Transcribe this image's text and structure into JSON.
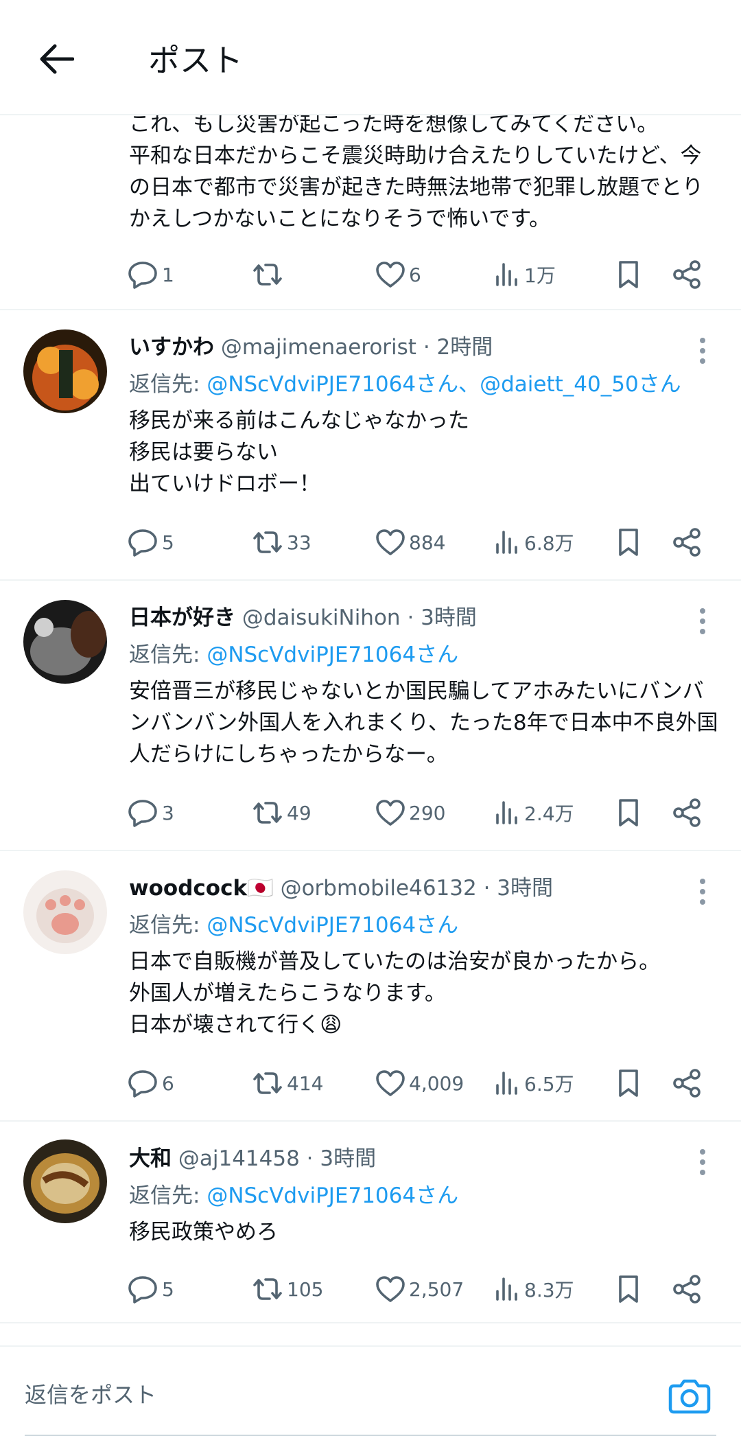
{
  "header": {
    "title": "ポスト"
  },
  "partial_post": {
    "text": "これ、もし災害が起こった時を想像してみてください。\n平和な日本だからこそ震災時助け合えたりしていたけど、今の日本で都市で災害が起きた時無法地帯で犯罪し放題でとりかえしつかないことになりそうで怖いです。",
    "replies": "1",
    "reposts": "",
    "likes": "6",
    "views": "1万"
  },
  "replies": [
    {
      "name": "いすかわ",
      "flag": "",
      "handle": "@majimenaerorist",
      "dot": "·",
      "time": "2時間",
      "reply_prefix": "返信先: ",
      "mentions": "@NScVdviPJE71064さん、@daiett_40_50さん",
      "text": "移民が来る前はこんなじゃなかった\n移民は要らない\n出ていけドロボー！",
      "replies": "5",
      "reposts": "33",
      "likes": "884",
      "views": "6.8万",
      "avatar_colors": [
        "#2a1a0a",
        "#c7561a",
        "#f0a030"
      ]
    },
    {
      "name": "日本が好き",
      "flag": "",
      "handle": "@daisukiNihon",
      "dot": "·",
      "time": "3時間",
      "reply_prefix": "返信先: ",
      "mentions": "@NScVdviPJE71064さん",
      "text": "安倍晋三が移民じゃないとか国民騙してアホみたいにバンバンバンバン外国人を入れまくり、たった8年で日本中不良外国人だらけにしちゃったからなー。",
      "replies": "3",
      "reposts": "49",
      "likes": "290",
      "views": "2.4万",
      "avatar_colors": [
        "#1a1a1a",
        "#777777",
        "#4a2a1a"
      ]
    },
    {
      "name": "woodcock",
      "flag": "🇯🇵",
      "handle": "@orbmobile46132",
      "dot": "·",
      "time": "3時間",
      "reply_prefix": "返信先: ",
      "mentions": "@NScVdviPJE71064さん",
      "text": "日本で自販機が普及していたのは治安が良かったから。\n外国人が増えたらこうなります。\n日本が壊されて行く😩",
      "replies": "6",
      "reposts": "414",
      "likes": "4,009",
      "views": "6.5万",
      "avatar_colors": [
        "#e9dcd6",
        "#e89a8e",
        "#f4efec"
      ]
    },
    {
      "name": "大和",
      "flag": "",
      "handle": "@aj141458",
      "dot": "·",
      "time": "3時間",
      "reply_prefix": "返信先: ",
      "mentions": "@NScVdviPJE71064さん",
      "text": "移民政策やめろ",
      "replies": "5",
      "reposts": "105",
      "likes": "2,507",
      "views": "8.3万",
      "avatar_colors": [
        "#2b2418",
        "#b98a3a",
        "#d9c08a"
      ]
    }
  ],
  "compose": {
    "placeholder": "返信をポスト"
  },
  "icons": {
    "back": "arrow-left-icon",
    "more": "vertical-dots-icon",
    "reply": "speech-bubble-icon",
    "repost": "repost-arrows-icon",
    "like": "heart-icon",
    "views": "bar-chart-icon",
    "bookmark": "bookmark-icon",
    "share": "share-icon",
    "camera": "camera-icon"
  },
  "colors": {
    "accent": "#1d9bf0",
    "secondary_text": "#536471",
    "divider": "#eff3f4"
  }
}
